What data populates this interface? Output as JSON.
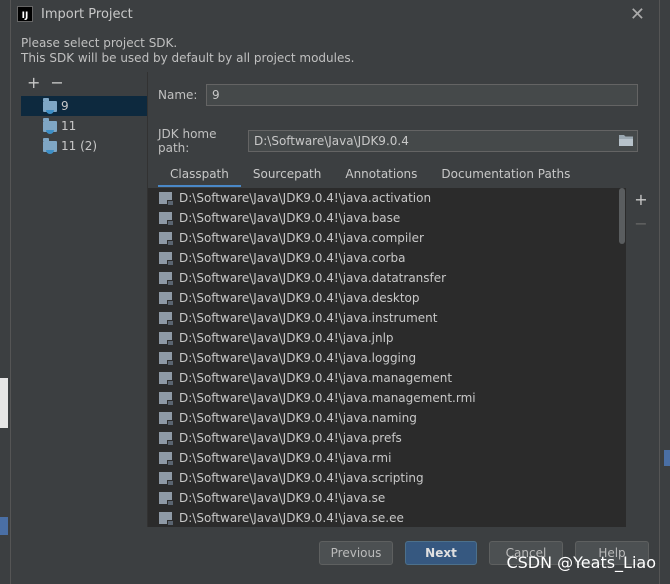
{
  "window": {
    "title": "Import Project",
    "app_icon_text": "IJ"
  },
  "description": {
    "line1": "Please select project SDK.",
    "line2": "This SDK will be used by default by all project modules."
  },
  "sdk_tree": {
    "add": "+",
    "remove": "−",
    "items": [
      {
        "label": "9",
        "selected": true
      },
      {
        "label": "11",
        "selected": false
      },
      {
        "label": "11 (2)",
        "selected": false
      }
    ]
  },
  "form": {
    "name_label": "Name:",
    "name_value": "9",
    "jdk_home_label": "JDK home path:",
    "jdk_home_value": "D:\\Software\\Java\\JDK9.0.4"
  },
  "tabs": [
    {
      "label": "Classpath",
      "active": true
    },
    {
      "label": "Sourcepath",
      "active": false
    },
    {
      "label": "Annotations",
      "active": false
    },
    {
      "label": "Documentation Paths",
      "active": false
    }
  ],
  "classpath": [
    "D:\\Software\\Java\\JDK9.0.4!\\java.activation",
    "D:\\Software\\Java\\JDK9.0.4!\\java.base",
    "D:\\Software\\Java\\JDK9.0.4!\\java.compiler",
    "D:\\Software\\Java\\JDK9.0.4!\\java.corba",
    "D:\\Software\\Java\\JDK9.0.4!\\java.datatransfer",
    "D:\\Software\\Java\\JDK9.0.4!\\java.desktop",
    "D:\\Software\\Java\\JDK9.0.4!\\java.instrument",
    "D:\\Software\\Java\\JDK9.0.4!\\java.jnlp",
    "D:\\Software\\Java\\JDK9.0.4!\\java.logging",
    "D:\\Software\\Java\\JDK9.0.4!\\java.management",
    "D:\\Software\\Java\\JDK9.0.4!\\java.management.rmi",
    "D:\\Software\\Java\\JDK9.0.4!\\java.naming",
    "D:\\Software\\Java\\JDK9.0.4!\\java.prefs",
    "D:\\Software\\Java\\JDK9.0.4!\\java.rmi",
    "D:\\Software\\Java\\JDK9.0.4!\\java.scripting",
    "D:\\Software\\Java\\JDK9.0.4!\\java.se",
    "D:\\Software\\Java\\JDK9.0.4!\\java.se.ee"
  ],
  "side_tools": {
    "add": "+",
    "remove": "−"
  },
  "buttons": {
    "previous": "Previous",
    "next": "Next",
    "cancel": "Cancel",
    "help": "Help"
  },
  "watermark": "CSDN @Yeats_Liao",
  "colors": {
    "background": "#3c3f41",
    "list_background": "#2b2b2b",
    "selection": "#0d293e",
    "primary_button": "#365880",
    "tab_underline": "#4a88c7"
  },
  "icons": {
    "close": "close-icon",
    "folder": "sdk-folder-icon",
    "jar": "jar-icon",
    "browse": "folder-browse-icon"
  }
}
